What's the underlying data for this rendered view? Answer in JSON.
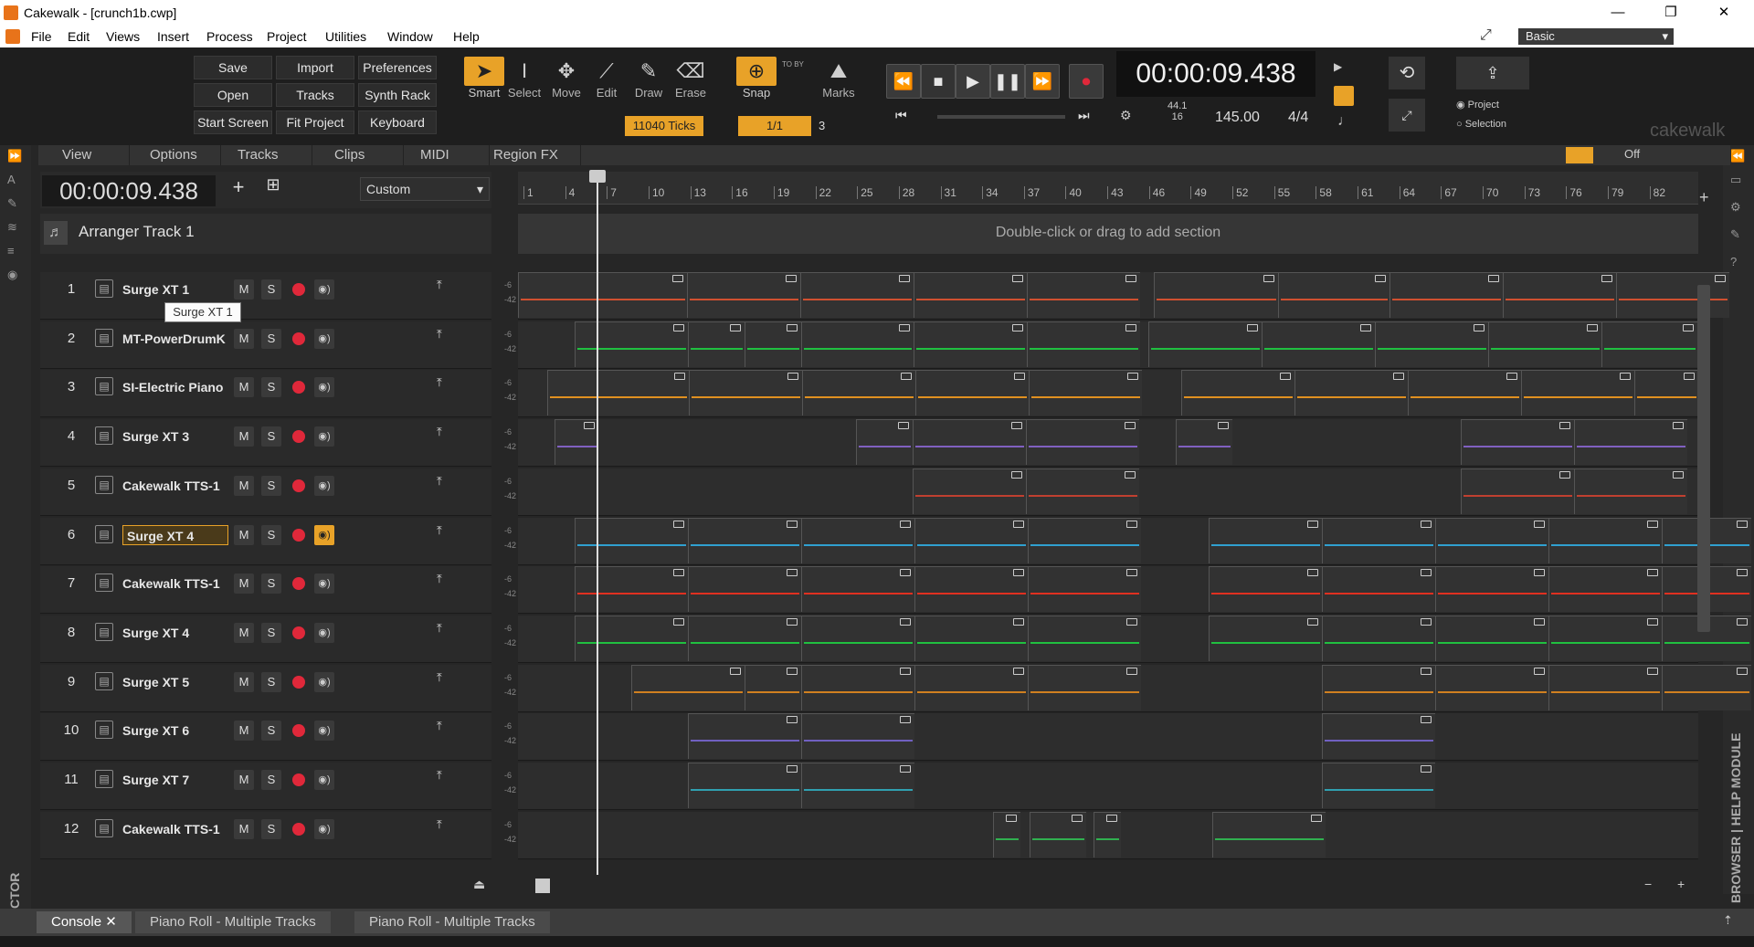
{
  "window": {
    "title": "Cakewalk - [crunch1b.cwp]",
    "minimize": "—",
    "restore": "❐",
    "close": "✕"
  },
  "menu": [
    "File",
    "Edit",
    "Views",
    "Insert",
    "Process",
    "Project",
    "Utilities",
    "Window",
    "Help"
  ],
  "workspace": "Basic",
  "control_bar": {
    "buttons": [
      [
        "Save",
        "Import",
        "Preferences"
      ],
      [
        "Open",
        "Tracks",
        "Synth Rack"
      ],
      [
        "Start Screen",
        "Fit Project",
        "Keyboard"
      ]
    ],
    "tools": [
      {
        "name": "Smart",
        "icon": "cursor-icon"
      },
      {
        "name": "Select",
        "icon": "ibeam-icon"
      },
      {
        "name": "Move",
        "icon": "move-icon"
      },
      {
        "name": "Edit",
        "icon": "edit-icon"
      },
      {
        "name": "Draw",
        "icon": "pencil-icon"
      },
      {
        "name": "Erase",
        "icon": "eraser-icon"
      }
    ],
    "ticks": "11040 Ticks",
    "snap": "Snap",
    "snap_value": "1/1",
    "snap_num": "3",
    "to_by": "TO BY",
    "marks": "Marks",
    "time": "00:00:09.438",
    "sample_rate": "44.1",
    "bit_depth": "16",
    "tempo": "145.00",
    "meter": "4/4",
    "export_project": "Project",
    "export_selection": "Selection",
    "brand": "cakewalk"
  },
  "track_view": {
    "menus": [
      "View",
      "Options",
      "Tracks",
      "Clips",
      "MIDI",
      "Region FX"
    ],
    "time_display": "00:00:09.438",
    "preset": "Custom",
    "arranger_track": "Arranger Track 1",
    "arranger_hint": "Double-click or drag to add section",
    "fx_off": "Off",
    "ruler": [
      "1",
      "4",
      "7",
      "10",
      "13",
      "16",
      "19",
      "22",
      "25",
      "28",
      "31",
      "34",
      "37",
      "40",
      "43",
      "46",
      "49",
      "52",
      "55",
      "58",
      "61",
      "64",
      "67",
      "70",
      "73",
      "76",
      "79",
      "82"
    ],
    "tooltip": "Surge XT 1",
    "meter_labels": [
      "-6",
      "-42"
    ],
    "mute": "M",
    "solo": "S"
  },
  "tracks": [
    {
      "num": "1",
      "name": "Surge XT 1",
      "color": "#d05030"
    },
    {
      "num": "2",
      "name": "MT-PowerDrumK",
      "color": "#20c040"
    },
    {
      "num": "3",
      "name": "SI-Electric Piano",
      "color": "#e09020"
    },
    {
      "num": "4",
      "name": "Surge XT 3",
      "color": "#8060c0"
    },
    {
      "num": "5",
      "name": "Cakewalk TTS-1",
      "color": "#c04030"
    },
    {
      "num": "6",
      "name": "Surge XT 4",
      "color": "#30a0d0",
      "selected": true
    },
    {
      "num": "7",
      "name": "Cakewalk TTS-1",
      "color": "#e03020"
    },
    {
      "num": "8",
      "name": "Surge XT 4",
      "color": "#20c040"
    },
    {
      "num": "9",
      "name": "Surge XT 5",
      "color": "#d08020"
    },
    {
      "num": "10",
      "name": "Surge XT 6",
      "color": "#7060c0"
    },
    {
      "num": "11",
      "name": "Surge XT 7",
      "color": "#30a0b0"
    },
    {
      "num": "12",
      "name": "Cakewalk TTS-1",
      "color": "#30b050"
    }
  ],
  "bottom_tabs": [
    {
      "label": "Console",
      "active": true
    },
    {
      "label": "Piano Roll - Multiple Tracks"
    },
    {
      "label": "Piano Roll - Multiple Tracks"
    }
  ],
  "side_labels": {
    "inspector": "INSPECTOR",
    "browser": "BROWSER | HELP MODULE"
  }
}
